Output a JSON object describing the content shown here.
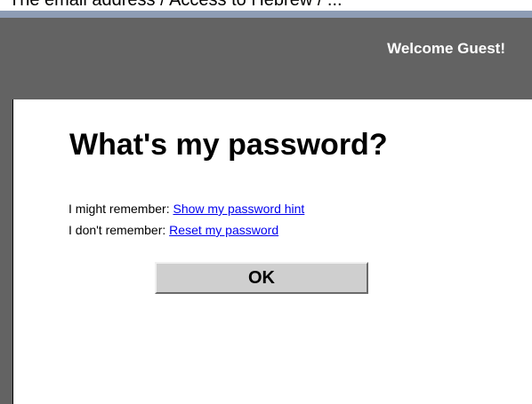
{
  "top_cut_text": "The email address / Access to Hebrew / ...",
  "header": {
    "welcome_text": "Welcome Guest!"
  },
  "dialog": {
    "title": "What's my password?",
    "options": [
      {
        "prefix": "I might remember: ",
        "link_label": "Show my password hint"
      },
      {
        "prefix": "I don't remember: ",
        "link_label": "Reset my password"
      }
    ],
    "ok_label": "OK"
  },
  "colors": {
    "header_background": "#636363",
    "top_strip": "#8e9db6",
    "link": "#0000ee",
    "button_face": "#cfcfcf"
  }
}
